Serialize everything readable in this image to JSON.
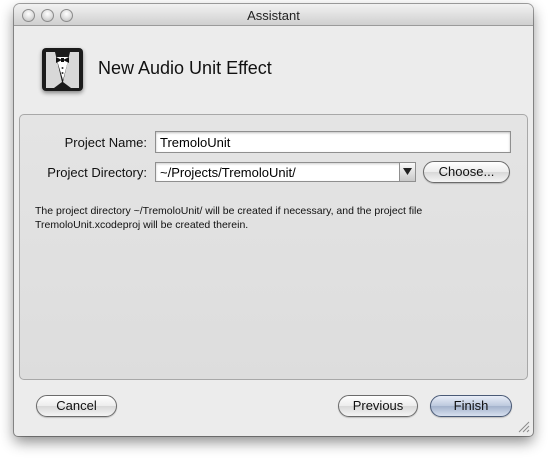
{
  "window": {
    "title": "Assistant"
  },
  "header": {
    "title": "New Audio Unit Effect",
    "icon": "tuxedo-icon"
  },
  "form": {
    "project_name_label": "Project Name:",
    "project_name_value": "TremoloUnit",
    "project_directory_label": "Project Directory:",
    "project_directory_value": "~/Projects/TremoloUnit/",
    "choose_button": "Choose...",
    "note_line1": "The project directory ~/TremoloUnit/ will be created if necessary, and the project file",
    "note_line2": "TremoloUnit.xcodeproj will be created therein."
  },
  "footer": {
    "cancel_button": "Cancel",
    "previous_button": "Previous",
    "finish_button": "Finish"
  },
  "colors": {
    "window_bg": "#ececec",
    "default_button": "#a3b2cc"
  }
}
